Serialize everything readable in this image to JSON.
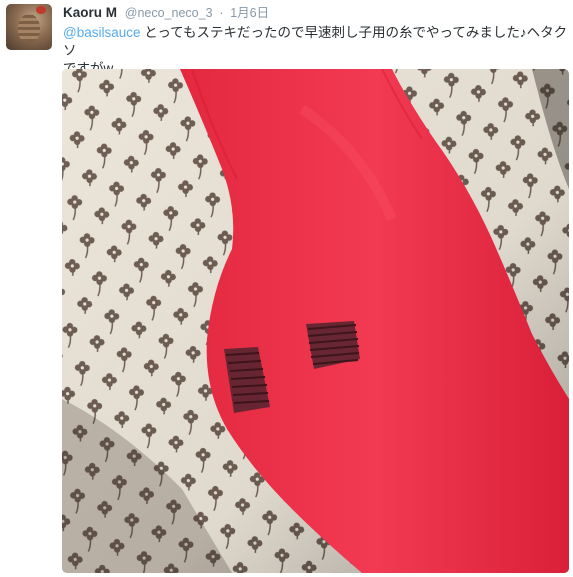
{
  "tweet": {
    "author_name": "Kaoru M",
    "handle": "@neco_neco_3",
    "separator": "·",
    "timestamp": "1月6日",
    "mention": "@basilsauce",
    "body_line1": " とってもステキだったので早速刺し子用の糸でやってみました♪ヘタクソ",
    "body_line2": "ですがw"
  },
  "media": {
    "sock_color": "#f0364f",
    "fabric_color": "#ece5d9",
    "pattern_color": "#6f5f54"
  }
}
